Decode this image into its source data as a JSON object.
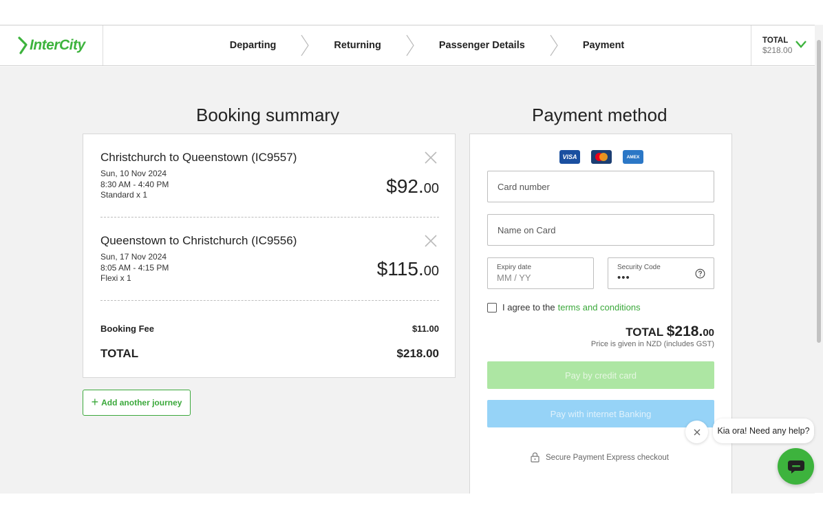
{
  "brand": {
    "name": "InterCity",
    "color": "#3db33d"
  },
  "steps": [
    "Departing",
    "Returning",
    "Passenger Details",
    "Payment"
  ],
  "header_total": {
    "label": "TOTAL",
    "amount": "$218.00"
  },
  "booking": {
    "title": "Booking summary",
    "journeys": [
      {
        "route": "Christchurch to Queenstown (IC9557)",
        "date": "Sun, 10 Nov 2024",
        "time": "8:30 AM - 4:40 PM",
        "fare": "Standard x 1",
        "price_main": "$92.",
        "price_cents": "00"
      },
      {
        "route": "Queenstown to Christchurch (IC9556)",
        "date": "Sun, 17 Nov 2024",
        "time": "8:05 AM - 4:15 PM",
        "fare": "Flexi x 1",
        "price_main": "$115.",
        "price_cents": "00"
      }
    ],
    "fee_label": "Booking Fee",
    "fee_amount": "$11.00",
    "total_label": "TOTAL",
    "total_amount": "$218.00",
    "add_journey": "Add another journey"
  },
  "payment": {
    "title": "Payment method",
    "card_logos": [
      "VISA",
      "mastercard",
      "AMEX"
    ],
    "card_number_placeholder": "Card number",
    "name_placeholder": "Name on Card",
    "expiry_label": "Expiry date",
    "expiry_placeholder": "MM / YY",
    "security_label": "Security Code",
    "security_placeholder": "•••",
    "agree_text": "I agree to the",
    "terms_link": "terms and conditions",
    "total_label": "TOTAL",
    "total_main": "$218.",
    "total_cents": "00",
    "gst_note": "Price is given in NZD (includes GST)",
    "pay_card_button": "Pay by credit card",
    "pay_bank_button": "Pay with internet Banking",
    "secure_note": "Secure Payment Express checkout"
  },
  "chat": {
    "message": "Kia ora! Need any help?"
  }
}
